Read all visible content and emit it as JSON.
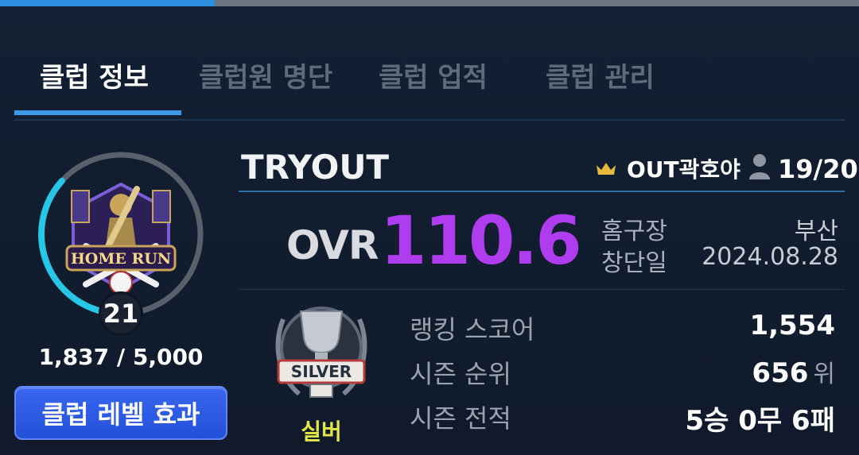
{
  "tabs": [
    {
      "label": "클럽 정보",
      "active": true
    },
    {
      "label": "클럽원 명단",
      "active": false
    },
    {
      "label": "클럽 업적",
      "active": false
    },
    {
      "label": "클럽 관리",
      "active": false
    }
  ],
  "club": {
    "name": "TRYOUT",
    "master": "OUT곽호야",
    "members": "19/20",
    "ovr_label": "OVR",
    "ovr_value": "110.6",
    "home_label": "홈구장",
    "home_value": "부산",
    "founded_label": "창단일",
    "founded_value": "2024.08.28",
    "emblem_text": "HOME RUN"
  },
  "level": {
    "value": "21",
    "progress_text": "1,837 / 5,000",
    "progress_fraction": 0.367,
    "button_label": "클럽 레벨 효과"
  },
  "tier": {
    "name": "실버",
    "emblem_text": "SILVER"
  },
  "stats": {
    "ranking_label": "랭킹 스코어",
    "ranking_value": "1,554",
    "season_rank_label": "시즌 순위",
    "season_rank_value": "656",
    "season_rank_unit": "위",
    "season_record_label": "시즌 전적",
    "season_record_value": "5승 0무 6패"
  },
  "colors": {
    "accent": "#3a9ce6",
    "ovr": "#b03cf0",
    "tier": "#e2e84a",
    "button": "#2f5ce6"
  }
}
